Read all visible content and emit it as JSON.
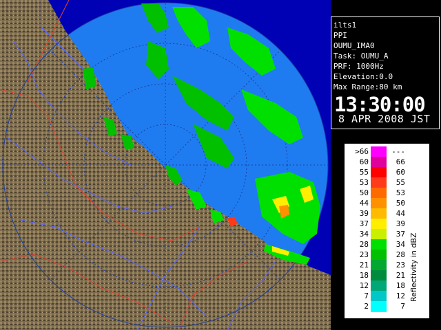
{
  "info": {
    "lines": [
      "ilts1",
      "PPI",
      "OUMU_IMA0",
      "Task: OUMU_A",
      "PRF: 1000Hz",
      "Elevation:0.0",
      "Max Range:80 km"
    ],
    "time": "13:30:00",
    "date": "8 APR 2008 JST"
  },
  "legend": {
    "title": "Reflectivity in dBZ",
    "bins": [
      {
        "lo": ">66",
        "hi": "---",
        "color": "#ff00ff"
      },
      {
        "lo": "60",
        "hi": "66",
        "color": "#e0009a"
      },
      {
        "lo": "55",
        "hi": "60",
        "color": "#ff0000"
      },
      {
        "lo": "53",
        "hi": "55",
        "color": "#ff3a1a"
      },
      {
        "lo": "50",
        "hi": "53",
        "color": "#ff6a00"
      },
      {
        "lo": "44",
        "hi": "50",
        "color": "#ff9000"
      },
      {
        "lo": "39",
        "hi": "44",
        "color": "#ffbb00"
      },
      {
        "lo": "37",
        "hi": "39",
        "color": "#ffee00"
      },
      {
        "lo": "34",
        "hi": "37",
        "color": "#c8f000"
      },
      {
        "lo": "28",
        "hi": "34",
        "color": "#00e000"
      },
      {
        "lo": "23",
        "hi": "28",
        "color": "#00c000"
      },
      {
        "lo": "21",
        "hi": "23",
        "color": "#00a830"
      },
      {
        "lo": "18",
        "hi": "21",
        "color": "#008c3c"
      },
      {
        "lo": "12",
        "hi": "18",
        "color": "#00a878"
      },
      {
        "lo": "7",
        "hi": "12",
        "color": "#00c8c8"
      },
      {
        "lo": "2",
        "hi": "7",
        "color": "#00ffff"
      }
    ]
  },
  "colors": {
    "sea": "#1f7cf0",
    "land": "#7b6a4c",
    "outside_range": "#0000b4",
    "rivers": "#5566ff",
    "borders": "#dd4433"
  }
}
